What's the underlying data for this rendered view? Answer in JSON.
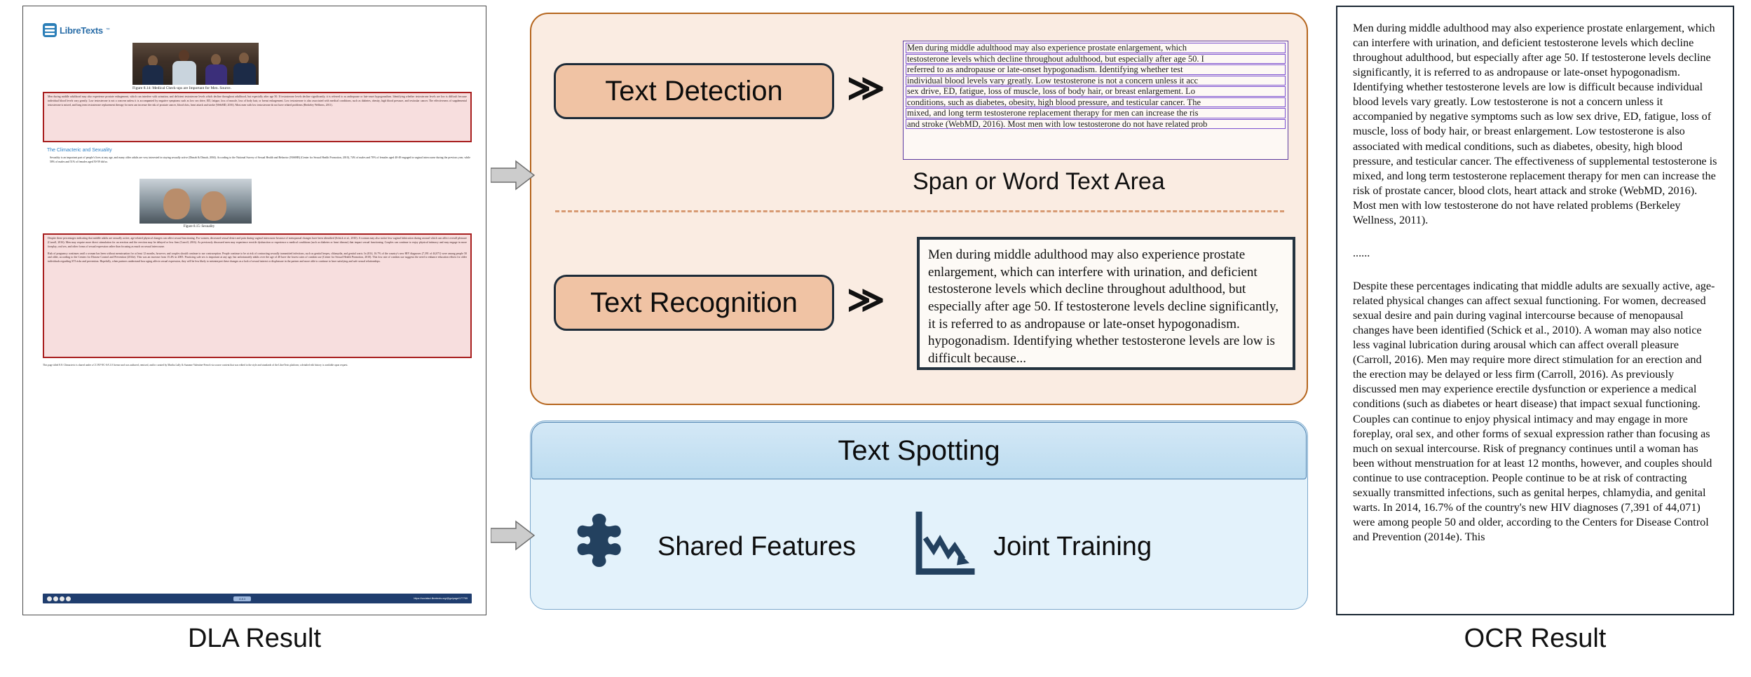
{
  "captions": {
    "dla": "DLA Result",
    "ocr": "OCR Result"
  },
  "dla": {
    "logo_text": "LibreTexts",
    "logo_tm": "™",
    "figure1_caption": "Figure 8.14: Medical Check-ups are Important for Men. Source.",
    "figure2_caption": "Figure 8.15: Sexuality",
    "redbox_1": "Men during middle adulthood may also experience prostate enlargement, which can interfere with urination, and deficient testosterone levels which decline throughout adulthood, but especially after age 50. If testosterone levels decline significantly, it is referred to as andropause or late-onset hypogonadism. Identifying whether testosterone levels are low is difficult because individual blood levels vary greatly. Low testosterone is not a concern unless it is accompanied by negative symptoms such as low sex drive, ED, fatigue, loss of muscle, loss of body hair, or breast enlargement. Low testosterone is also associated with medical conditions, such as diabetes, obesity, high blood pressure, and testicular cancer. The effectiveness of supplemental testosterone is mixed, and long term testosterone replacement therapy for men can increase the risk of prostate cancer, blood clots, heart attack and stroke (WebMD, 2016). Most men with low testosterone do not have related problems (Berkeley Wellness, 2011).",
    "heading_1": "The Climacteric and Sexuality",
    "para_1": "Sexuality is an important part of people's lives at any age, and many older adults are very interested in staying sexually active (Dimah & Dimah, 2004). According to the National Survey of Sexual Health and Behavior (NSSHB) (Center for Sexual Health Promotion, 2010), 74% of males and 70% of females aged 40-49 engaged in vaginal intercourse during the previous year, while 58% of males and 51% of females aged 50-59 did so.",
    "redbox_2": "Despite these percentages indicating that middle adults are sexually active, age-related physical changes can affect sexual functioning. For women, decreased sexual desire and pain during vaginal intercourse because of menopausal changes have been identified (Schick et al., 2010). A woman may also notice less vaginal lubrication during arousal which can affect overall pleasure (Carroll, 2016). Men may require more direct stimulation for an erection and the erection may be delayed or less firm (Carroll, 2016). As previously discussed men may experience erectile dysfunction or experience a medical conditions (such as diabetes or heart disease) that impact sexual functioning. Couples can continue to enjoy physical intimacy and may engage in more foreplay, oral sex, and other forms of sexual expression rather than focusing as much on sexual intercourse.",
    "redbox_2b": "Risk of pregnancy continues until a woman has been without menstruation for at least 12 months, however, and couples should continue to use contraception. People continue to be at risk of contracting sexually transmitted infections, such as genital herpes, chlamydia, and genital warts. In 2014, 16.7% of the country's new HIV diagnoses (7,391 of 44,071) were among people 50 and older, according to the Centers for Disease Control and Prevention (2014e). This was an increase from 15.4% in 2005. Practicing safe sex is important at any age, but unfortunately adults over the age of 40 have the lowest rates of condom use (Center for Sexual Health Promotion, 2010). This low rate of condom use suggests the need to enhance education efforts for older individuals regarding STI risks and prevention. Hopefully, when partners understand how aging affects sexual expression, they will be less likely to misinterpret these changes as a lack of sexual interest or displeasure in the partner and more able to continue to have satisfying and safe sexual relationships.",
    "license_text": "This page titled 8.8: Climacteric is shared under a CC BY-NC-SA 3.0 license and was authored, remixed, and/or curated by Martha Lally & Suzanne Valentine-French via source content that was edited to the style and standards of the LibreTexts platform; a detailed edit history is available upon request.",
    "license_link_1": "CC BY-NC-SA 3.0",
    "license_link_2": "Martha Lally & Suzanne Valentine-French",
    "license_link_3": "source content",
    "footer_page": "8.8.3",
    "footer_url": "https://socialsci.libretexts.org/@go/page/177799"
  },
  "pipeline": {
    "detection_label": "Text Detection",
    "recognition_label": "Text Recognition",
    "spotting_label": "Text Spotting",
    "span_or_word_label": "Span or Word Text Area",
    "shared_features_label": "Shared Features",
    "joint_training_label": "Joint Training",
    "chevron": "≫",
    "detection_lines": [
      "Men during middle adulthood may also experience prostate enlargement, which",
      "testosterone levels which decline throughout adulthood, but especially after age 50. I",
      "referred to as andropause or late-onset hypogonadism. Identifying whether test",
      "individual blood levels vary greatly. Low testosterone is not a concern unless it acc",
      "sex drive, ED, fatigue, loss of muscle, loss of body hair, or breast enlargement. Lo",
      "conditions, such as diabetes, obesity, high blood pressure, and testicular cancer. The",
      "mixed, and long term testosterone replacement therapy for men can increase the ris",
      "and stroke (WebMD, 2016). Most men with low testosterone do not have related prob"
    ],
    "recognition_text": "Men during middle adulthood may also experience prostate enlargement, which can interfere with urination, and deficient testosterone levels which decline throughout adulthood, but especially after age 50. If testosterone levels decline significantly, it is referred to as andropause or late-onset hypogonadism. hypogonadism. Identifying whether testosterone levels are low is difficult because..."
  },
  "ocr": {
    "paragraph_1": "Men during middle adulthood may also experience prostate enlargement, which can interfere with urination, and deficient testosterone levels which decline throughout adulthood, but especially after age 50. If testosterone levels decline significantly, it is referred to as andropause or late-onset hypogonadism. Identifying whether testosterone levels are low is difficult because individual blood levels vary greatly. Low testosterone is not a concern unless it accompanied by negative symptoms such as low sex drive, ED, fatigue, loss of muscle, loss of body hair, or breast enlargement. Low testosterone is also associated with medical conditions, such as diabetes, obesity, high blood pressure, and testicular cancer. The effectiveness of supplemental testosterone is mixed, and long term testosterone replacement therapy for men can increase the risk of prostate cancer, blood clots, heart attack and stroke (WebMD, 2016). Most men with low testosterone do not have related problems (Berkeley Wellness, 2011).",
    "ellipsis": "......",
    "paragraph_2": "Despite these percentages indicating that middle adults are sexually active, age-related physical changes can affect sexual functioning. For women, decreased sexual desire and pain during vaginal intercourse because of menopausal changes have been identified (Schick et al., 2010). A woman may also notice less vaginal lubrication during arousal which can affect overall pleasure (Carroll, 2016). Men may require more direct stimulation for an erection and the erection may be delayed or less firm (Carroll, 2016). As previously discussed men may experience erectile dysfunction or experience a medical conditions (such as diabetes or heart disease) that impact sexual functioning. Couples can continue to enjoy physical intimacy and may engage in more foreplay, oral sex, and other forms of sexual expression rather than focusing as much on sexual intercourse. Risk of pregnancy continues until a woman has been without menstruation for at least 12 months, however, and couples should continue to use contraception. People continue to be at risk of contracting sexually transmitted infections, such as genital herpes, chlamydia, and genital warts. In 2014, 16.7% of the country's new HIV diagnoses (7,391 of 44,071) were among people 50 and older, according to the Centers for Disease Control and Prevention (2014e). This"
  },
  "colors": {
    "orange_panel_bg": "#faece2",
    "orange_panel_border": "#b5651d",
    "stage_button_bg": "#f0c3a4",
    "stage_button_border": "#1d2b38",
    "blue_panel_bg": "#e3f2fb",
    "blue_header_bg": "#bcdcf0",
    "detection_box_border": "#7b4fd0",
    "red_region_border": "#a81f1f",
    "red_region_bg": "#f7dede",
    "icon_navy": "#23415f",
    "arrow_gray": "#c8c8c8"
  }
}
